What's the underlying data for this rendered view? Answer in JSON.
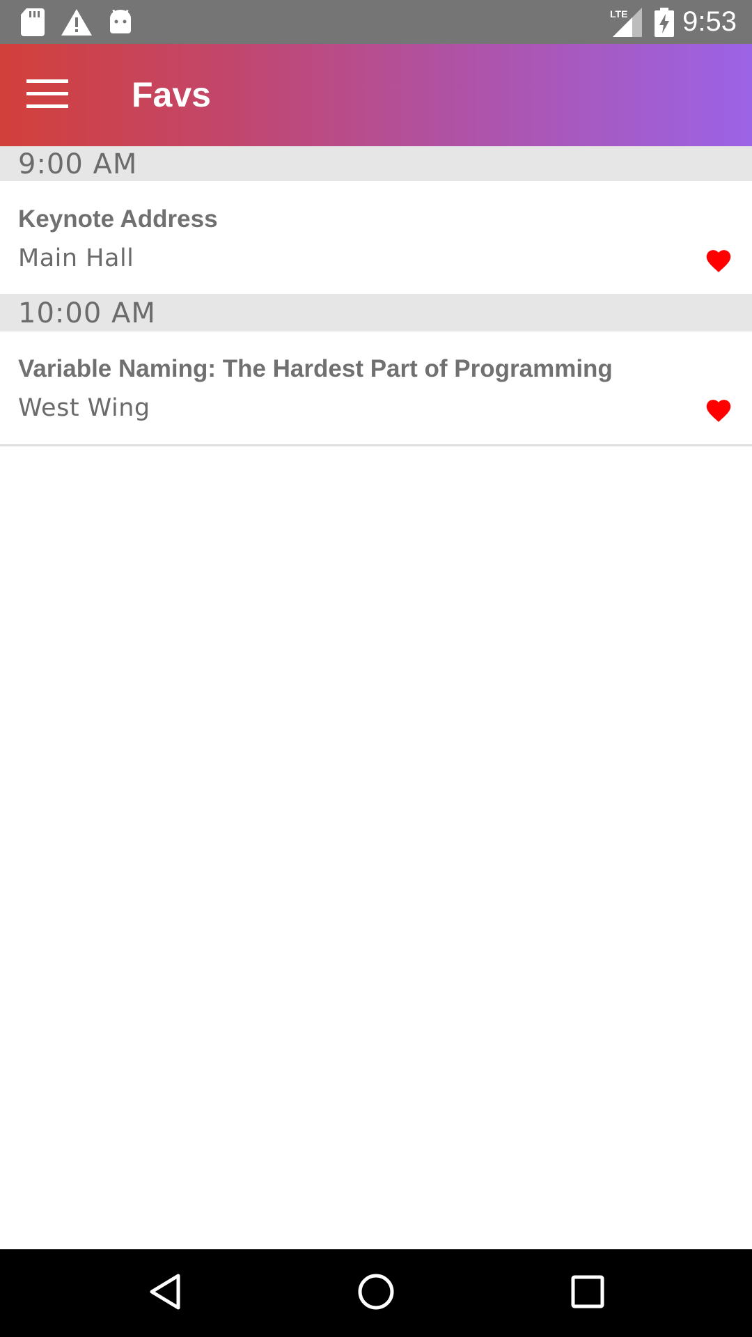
{
  "status_bar": {
    "time": "9:53",
    "network_label": "LTE",
    "icons": [
      "sd-card-icon",
      "warning-icon",
      "android-icon",
      "lte-signal-icon",
      "battery-charging-icon"
    ]
  },
  "app_bar": {
    "title": "Favs",
    "menu_icon": "hamburger-menu-icon",
    "gradient": [
      "#d2403a",
      "#9b63e6"
    ]
  },
  "sections": [
    {
      "time": "9:00 AM",
      "sessions": [
        {
          "title": "Keynote Address",
          "location": "Main Hall",
          "favorite": true
        }
      ]
    },
    {
      "time": "10:00 AM",
      "sessions": [
        {
          "title": "Variable Naming: The Hardest Part of Programming",
          "location": "West Wing",
          "favorite": true
        }
      ]
    }
  ],
  "colors": {
    "favorite": "#ff0000",
    "section_header_bg": "#e6e6e6",
    "text": "#6b6b6b"
  },
  "nav_bar": {
    "icons": [
      "back-icon",
      "home-icon",
      "recents-icon"
    ]
  }
}
